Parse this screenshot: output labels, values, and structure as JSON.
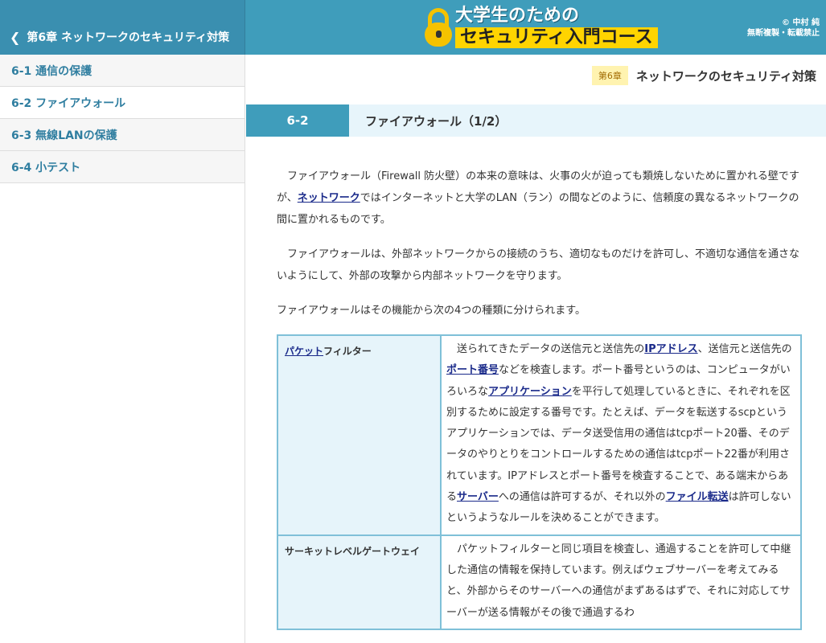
{
  "header": {
    "back_label": "第6章 ネットワークのセキュリティ対策",
    "logo_line1": "大学生のための",
    "logo_line2": "セキュリティ入門コース",
    "copyright_line1": "© 中村 純",
    "copyright_line2": "無断複製・転載禁止"
  },
  "sidebar": {
    "items": [
      {
        "label": "6-1 通信の保護"
      },
      {
        "label": "6-2 ファイアウォール"
      },
      {
        "label": "6-3 無線LANの保護"
      },
      {
        "label": "6-4 小テスト"
      }
    ]
  },
  "chapter": {
    "badge": "第6章",
    "name": "ネットワークのセキュリティ対策"
  },
  "section": {
    "number": "6-2",
    "title": "ファイアウォール（1/2）"
  },
  "paragraphs": {
    "p1_a": "ファイアウォール（Firewall 防火壁）の本来の意味は、火事の火が迫っても類焼しないために置かれる壁ですが、",
    "p1_link": "ネットワーク",
    "p1_b": "ではインターネットと大学のLAN（ラン）の間などのように、信頼度の異なるネットワークの間に置かれるものです。",
    "p2": "ファイアウォールは、外部ネットワークからの接続のうち、適切なものだけを許可し、不適切な通信を通さないようにして、外部の攻撃から内部ネットワークを守ります。",
    "p3": "ファイアウォールはその機能から次の4つの種類に分けられます。"
  },
  "table": {
    "row1": {
      "name_link": "パケット",
      "name_rest": "フィルター",
      "d1": "送られてきたデータの送信元と送信先の",
      "l1": "IPアドレス",
      "d2": "、送信元と送信先の",
      "l2": "ポート番号",
      "d3": "などを検査します。ポート番号というのは、コンピュータがいろいろな",
      "l3": "アプリケーション",
      "d4": "を平行して処理しているときに、それぞれを区別するために設定する番号です。たとえば、データを転送するscpというアプリケーションでは、データ送受信用の通信はtcpポート20番、そのデータのやりとりをコントロールするための通信はtcpポート22番が利用されています。IPアドレスとポート番号を検査することで、ある端末からある",
      "l4": "サーバー",
      "d5": "への通信は許可するが、それ以外の",
      "l5": "ファイル転送",
      "d6": "は許可しないというようなルールを決めることができます。"
    },
    "row2": {
      "name": "サーキットレベルゲートウェイ",
      "desc": "パケットフィルターと同じ項目を検査し、通過することを許可して中継した通信の情報を保持しています。例えばウェブサーバーを考えてみると、外部からそのサーバーへの通信がまずあるはずで、それに対応してサーバーが送る情報がその後で通過するわ"
    }
  },
  "colors": {
    "header_bg": "#3f9dbb",
    "accent_yellow": "#ffd400",
    "link": "#1a2a8a",
    "table_border": "#7fc0d8"
  },
  "icons": {
    "back": "chevron-left-icon",
    "logo": "padlock-icon"
  }
}
